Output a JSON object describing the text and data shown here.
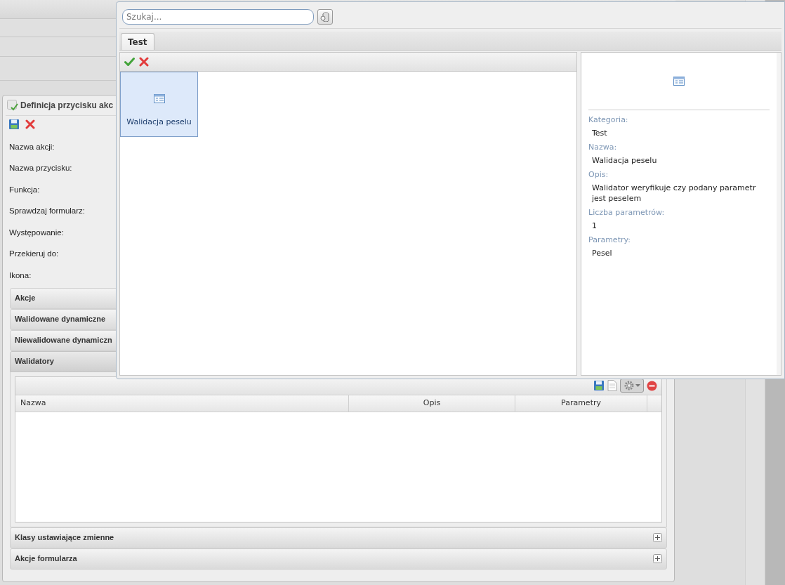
{
  "form": {
    "title": "Definicja przycisku akc",
    "fields": [
      "Nazwa akcji:",
      "Nazwa przycisku:",
      "Funkcja:",
      "Sprawdzaj formularz:",
      "Występowanie:",
      "Przekieruj do:",
      "Ikona:"
    ],
    "sections": [
      {
        "title": "Akcje",
        "expanded": false
      },
      {
        "title": "Walidowane dynamiczne",
        "expanded": false
      },
      {
        "title": "Niewalidowane dynamiczn",
        "expanded": false
      },
      {
        "title": "Walidatory",
        "expanded": true,
        "columns": [
          "Nazwa",
          "Opis",
          "Parametry"
        ]
      },
      {
        "title": "Klasy ustawiające zmienne",
        "expanded": false,
        "expand_button": true
      },
      {
        "title": "Akcje formularza",
        "expanded": false,
        "expand_button": true
      }
    ]
  },
  "dialog": {
    "search": {
      "placeholder": "Szukaj..."
    },
    "tabs": [
      {
        "label": "Test",
        "selected": true
      }
    ],
    "items": [
      {
        "label": "Walidacja peselu",
        "selected": true
      }
    ],
    "details": [
      {
        "label": "Kategoria:",
        "value": "Test"
      },
      {
        "label": "Nazwa:",
        "value": "Walidacja peselu"
      },
      {
        "label": "Opis:",
        "value": "Walidator weryfikuje czy podany parametr jest peselem"
      },
      {
        "label": "Liczba parametrów:",
        "value": "1"
      },
      {
        "label": "Parametry:",
        "value": "Pesel"
      }
    ]
  }
}
